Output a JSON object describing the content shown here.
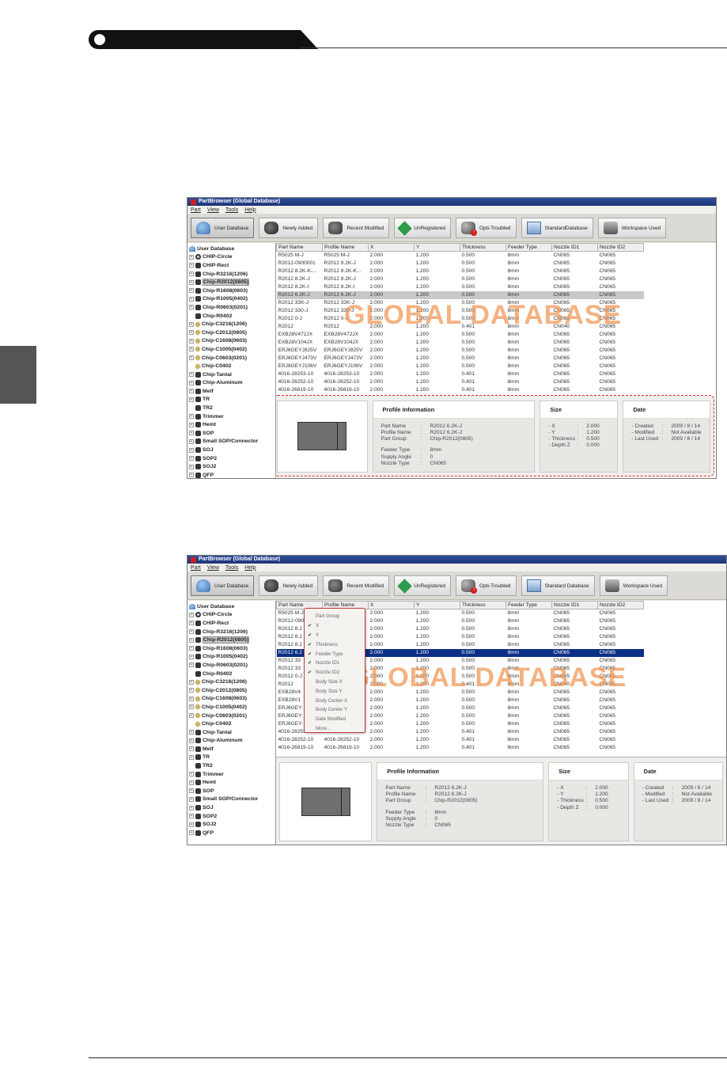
{
  "window_title": "PartBrowser (Global Database)",
  "menu": [
    "Part",
    "View",
    "Tools",
    "Help"
  ],
  "toolbar1": [
    {
      "label": "User Database",
      "icon": "user-database-icon"
    },
    {
      "label": "Newly Added",
      "icon": "newly-added-icon"
    },
    {
      "label": "Recent Modified",
      "icon": "recent-modified-icon"
    },
    {
      "label": "UnRegistered",
      "icon": "unregistered-icon"
    },
    {
      "label": "Opti-Troubled",
      "icon": "opti-troubled-icon"
    },
    {
      "label": "StandardDatabase",
      "icon": "standard-database-icon"
    },
    {
      "label": "Workspace Used",
      "icon": "workspace-used-icon"
    }
  ],
  "toolbar2": [
    {
      "label": "User Database"
    },
    {
      "label": "Newly Added"
    },
    {
      "label": "Recent Modified"
    },
    {
      "label": "UnRegistered"
    },
    {
      "label": "Opti-Troubled"
    },
    {
      "label": "Standard Database"
    },
    {
      "label": "Workspace Used"
    }
  ],
  "tree": {
    "root": "User Database",
    "items": [
      "CHIP-Circle",
      "CHIP-Rect",
      "Chip-R3216(1206)",
      "Chip-R2012(0805)",
      "Chip-R1608(0603)",
      "Chip-R1005(0402)",
      "Chip-R0603(0201)",
      "Chip-R0402",
      "Chip-C3216(1206)",
      "Chip-C2012(0805)",
      "Chip-C1608(0603)",
      "Chip-C1005(0402)",
      "Chip-C0603(0201)",
      "Chip-C0402",
      "Chip-Tantal",
      "Chip-Aluminum",
      "Melf",
      "TR",
      "TR2",
      "Trimmer",
      "Hemt",
      "SOP",
      "Small SOP/Connector",
      "SOJ",
      "SOP2",
      "SOJ2",
      "QFP"
    ]
  },
  "columns": [
    "Part Name",
    "Profile Name",
    "X",
    "Y",
    "Thickness",
    "Feeder Type",
    "Nozzle ID1",
    "Nozzle ID2"
  ],
  "rows1": [
    [
      "R5025 M-J",
      "R5025 M-J",
      "2.000",
      "1.200",
      "0.500",
      "8mm",
      "CN065",
      "CN065"
    ],
    [
      "R2012-0900001",
      "R2012 8.2K-J",
      "2.000",
      "1.200",
      "0.500",
      "8mm",
      "CN065",
      "CN065"
    ],
    [
      "R2012 8.2K-K-...",
      "R2012 8.2K-K...",
      "2.000",
      "1.200",
      "0.500",
      "8mm",
      "CN065",
      "CN065"
    ],
    [
      "R2012 8.2K-J",
      "R2012 8.2K-J",
      "2.000",
      "1.200",
      "0.500",
      "8mm",
      "CN065",
      "CN065"
    ],
    [
      "R2012 8.2K-I",
      "R2012 8.2K-I",
      "2.000",
      "1.200",
      "0.500",
      "8mm",
      "CN065",
      "CN065"
    ],
    [
      "R2012 6.2K-J",
      "R2012 6.2K-J",
      "2.000",
      "1.200",
      "0.500",
      "8mm",
      "CN065",
      "CN065"
    ],
    [
      "R2012 33K-J",
      "R2012 33K-J",
      "2.000",
      "1.200",
      "0.500",
      "8mm",
      "CN065",
      "CN065"
    ],
    [
      "R2012 330-J",
      "R2012 330-J",
      "2.000",
      "1.200",
      "0.500",
      "8mm",
      "CN065",
      "CN065"
    ],
    [
      "R2012 0-J",
      "R2012 0-J",
      "2.000",
      "1.200",
      "0.500",
      "8mm",
      "CN065",
      "CN065"
    ],
    [
      "R2012",
      "R2012",
      "2.000",
      "1.200",
      "0.401",
      "8mm",
      "CN040",
      "CN065"
    ],
    [
      "EXB28V472JX",
      "EXB28V472JX",
      "2.000",
      "1.200",
      "0.500",
      "8mm",
      "CN065",
      "CN065"
    ],
    [
      "EXB28V104JX",
      "EXB28V104JX",
      "2.000",
      "1.200",
      "0.500",
      "8mm",
      "CN065",
      "CN065"
    ],
    [
      "ERJ6GEYJ825V",
      "ERJ6GEYJ825V",
      "2.000",
      "1.200",
      "0.500",
      "8mm",
      "CN065",
      "CN065"
    ],
    [
      "ERJ6GEYJ473V",
      "ERJ6GEYJ473V",
      "2.000",
      "1.200",
      "0.500",
      "8mm",
      "CN065",
      "CN065"
    ],
    [
      "ERJ6GEYJ106V",
      "ERJ6GEYJ106V",
      "2.000",
      "1.200",
      "0.500",
      "8mm",
      "CN065",
      "CN065"
    ],
    [
      "4016-28253-10",
      "4016-28253-10",
      "2.000",
      "1.200",
      "0.401",
      "8mm",
      "CN065",
      "CN065"
    ],
    [
      "4016-28252-10",
      "4016-28252-10",
      "2.000",
      "1.200",
      "0.401",
      "8mm",
      "CN065",
      "CN065"
    ],
    [
      "4016-26819-10",
      "4016-26819-10",
      "2.000",
      "1.200",
      "0.401",
      "8mm",
      "CN065",
      "CN065"
    ]
  ],
  "rows2": [
    [
      "R5025 M-J",
      "",
      "2.000",
      "1.200",
      "0.500",
      "8mm",
      "CN065",
      "CN065"
    ],
    [
      "R2012-090",
      "",
      "2.000",
      "1.200",
      "0.500",
      "8mm",
      "CN065",
      "CN065"
    ],
    [
      "R2012 8.2",
      "",
      "2.000",
      "1.200",
      "0.500",
      "8mm",
      "CN065",
      "CN065"
    ],
    [
      "R2012 8.2",
      "",
      "2.000",
      "1.200",
      "0.500",
      "8mm",
      "CN065",
      "CN065"
    ],
    [
      "R2012 8.2",
      "",
      "2.000",
      "1.200",
      "0.500",
      "8mm",
      "CN065",
      "CN065"
    ],
    [
      "R2012 6.2",
      "",
      "2.000",
      "1.200",
      "0.500",
      "8mm",
      "CN065",
      "CN065"
    ],
    [
      "R2012 33",
      "",
      "2.000",
      "1.200",
      "0.500",
      "8mm",
      "CN065",
      "CN065"
    ],
    [
      "R2012 33",
      "",
      "2.000",
      "1.200",
      "0.500",
      "8mm",
      "CN065",
      "CN065"
    ],
    [
      "R2012 0-J",
      "",
      "2.000",
      "1.200",
      "0.500",
      "8mm",
      "CN065",
      "CN065"
    ],
    [
      "R2012",
      "",
      "2.000",
      "1.200",
      "0.401",
      "8mm",
      "CN040",
      "CN065"
    ],
    [
      "EXB28V4",
      "",
      "2.000",
      "1.200",
      "0.500",
      "8mm",
      "CN065",
      "CN065"
    ],
    [
      "EXB28V1",
      "",
      "2.000",
      "1.200",
      "0.500",
      "8mm",
      "CN065",
      "CN065"
    ],
    [
      "ERJ6GEY",
      "",
      "2.000",
      "1.200",
      "0.500",
      "8mm",
      "CN065",
      "CN065"
    ],
    [
      "ERJ6GEY",
      "",
      "2.000",
      "1.200",
      "0.500",
      "8mm",
      "CN065",
      "CN065"
    ],
    [
      "ERJ6GEY",
      "",
      "2.000",
      "1.200",
      "0.500",
      "8mm",
      "CN065",
      "CN065"
    ],
    [
      "4016-28253-10",
      "4016-28253-1...",
      "2.000",
      "1.200",
      "0.401",
      "8mm",
      "CN065",
      "CN065"
    ],
    [
      "4016-28252-10",
      "4016-28252-10",
      "2.000",
      "1.200",
      "0.401",
      "8mm",
      "CN065",
      "CN065"
    ],
    [
      "4016-26819-10",
      "4016-26819-10",
      "2.000",
      "1.200",
      "0.401",
      "8mm",
      "CN065",
      "CN065"
    ]
  ],
  "watermark": "GLOBAL DATABASE",
  "context_menu": [
    {
      "label": "Part Group",
      "checked": false
    },
    {
      "label": "X",
      "checked": true
    },
    {
      "label": "Y",
      "checked": true
    },
    {
      "label": "Thickness",
      "checked": true
    },
    {
      "label": "Feeder Type",
      "checked": true
    },
    {
      "label": "Nozzle ID1",
      "checked": true
    },
    {
      "label": "Nozzle ID2",
      "checked": true
    },
    {
      "label": "Body Size X",
      "checked": false
    },
    {
      "label": "Body Size Y",
      "checked": false
    },
    {
      "label": "Body Center X",
      "checked": false
    },
    {
      "label": "Body Center Y",
      "checked": false
    },
    {
      "label": "Date Modified",
      "checked": false
    },
    {
      "label": "More...",
      "checked": false
    }
  ],
  "detail": {
    "profile_title": "Profile Information",
    "size_title": "Size",
    "date_title": "Date",
    "profile": [
      {
        "k": "Part Name",
        "v": "R2012 6.2K-J"
      },
      {
        "k": "Profile Name",
        "v": "R2012 6.2K-J"
      },
      {
        "k": "Part Group",
        "v": "Chip-R2012(0805)"
      }
    ],
    "feeder": [
      {
        "k": "Feeder Type",
        "v": "8mm"
      },
      {
        "k": "Supply Angle",
        "v": "0"
      },
      {
        "k": "Nozzle Type",
        "v": "CN065"
      }
    ],
    "size": [
      {
        "k": "- X",
        "v": "2.000"
      },
      {
        "k": "- Y",
        "v": "1.200"
      },
      {
        "k": "- Thickness",
        "v": "0.500"
      },
      {
        "k": "- Depth Z",
        "v": "0.000"
      }
    ],
    "date": [
      {
        "k": "- Created",
        "v": "2009 / 8 / 14"
      },
      {
        "k": "- Modified",
        "v": "Not Available"
      },
      {
        "k": "- Last Used",
        "v": "2009 / 8 / 14"
      }
    ]
  },
  "selected_row_1": 5,
  "selected_row_2": 5,
  "selected_tree_item": "Chip-R2012(0805)"
}
